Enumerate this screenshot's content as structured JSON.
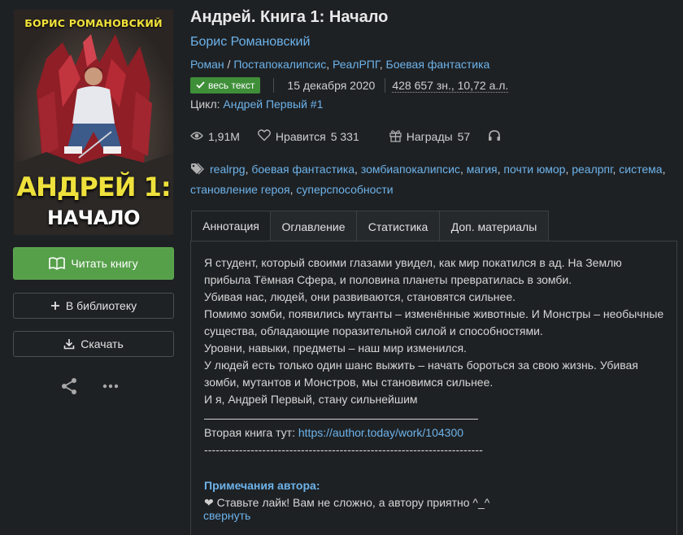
{
  "cover": {
    "author": "БОРИС РОМАНОВСКИЙ",
    "title_line1": "АНДРЕЙ 1:",
    "title_line2": "НАЧАЛО"
  },
  "actions": {
    "read_label": "Читать книгу",
    "library_label": "В библиотеку",
    "download_label": "Скачать"
  },
  "book": {
    "title": "Андрей. Книга 1: Начало",
    "author": "Борис Романовский",
    "genre_main": "Роман",
    "genre_sep": "/",
    "genres": [
      "Постапокалипсис",
      "РеалРПГ",
      "Боевая фантастика"
    ],
    "status_badge": "весь текст",
    "date": "15 декабря 2020",
    "size": "428 657 зн., 10,72 а.л.",
    "cycle_label": "Цикл:",
    "cycle_name": "Андрей Первый #1"
  },
  "stats": {
    "views": "1,91M",
    "likes_label": "Нравится",
    "likes_count": "5 331",
    "awards_label": "Награды",
    "awards_count": "57"
  },
  "tags": [
    "realrpg",
    "боевая фантастика",
    "зомбиапокалипсис",
    "магия",
    "почти юмор",
    "реалрпг",
    "система",
    "становление героя",
    "суперспособности"
  ],
  "tabs": [
    "Аннотация",
    "Оглавление",
    "Статистика",
    "Доп. материалы"
  ],
  "annotation": {
    "lines": [
      "Я студент, который своими глазами увидел, как мир покатился в ад. На Землю",
      "прибыла Тёмная Сфера, и половина планеты превратилась в зомби.",
      "Убивая нас, людей, они развиваются, становятся сильнее.",
      "Помимо зомби, появились мутанты – изменённые животные. И Монстры – необычные",
      "существа, обладающие поразительной силой и способностями.",
      "Уровни, навыки, предметы – наш мир изменился.",
      "У людей есть только один шанс выжить – начать бороться за свою жизнь. Убивая",
      "зомби, мутантов и Монстров, мы становимся сильнее.",
      "И я, Андрей Первый, стану сильнейшим"
    ],
    "second_book_label": "Вторая книга тут:",
    "second_book_link": "https://author.today/work/104300",
    "dashes": "------------------------------------------------------------------------",
    "notes_title": "Примечания автора:",
    "notes_text": "Ставьте лайк! Вам не сложно, а автору приятно ^_^",
    "collapse_label": "свернуть"
  },
  "colors": {
    "background": "#1e2124",
    "accent_link": "#6db3ea",
    "read_button": "#56a04a",
    "badge": "#3f8f39",
    "cover_title": "#efe13c"
  }
}
